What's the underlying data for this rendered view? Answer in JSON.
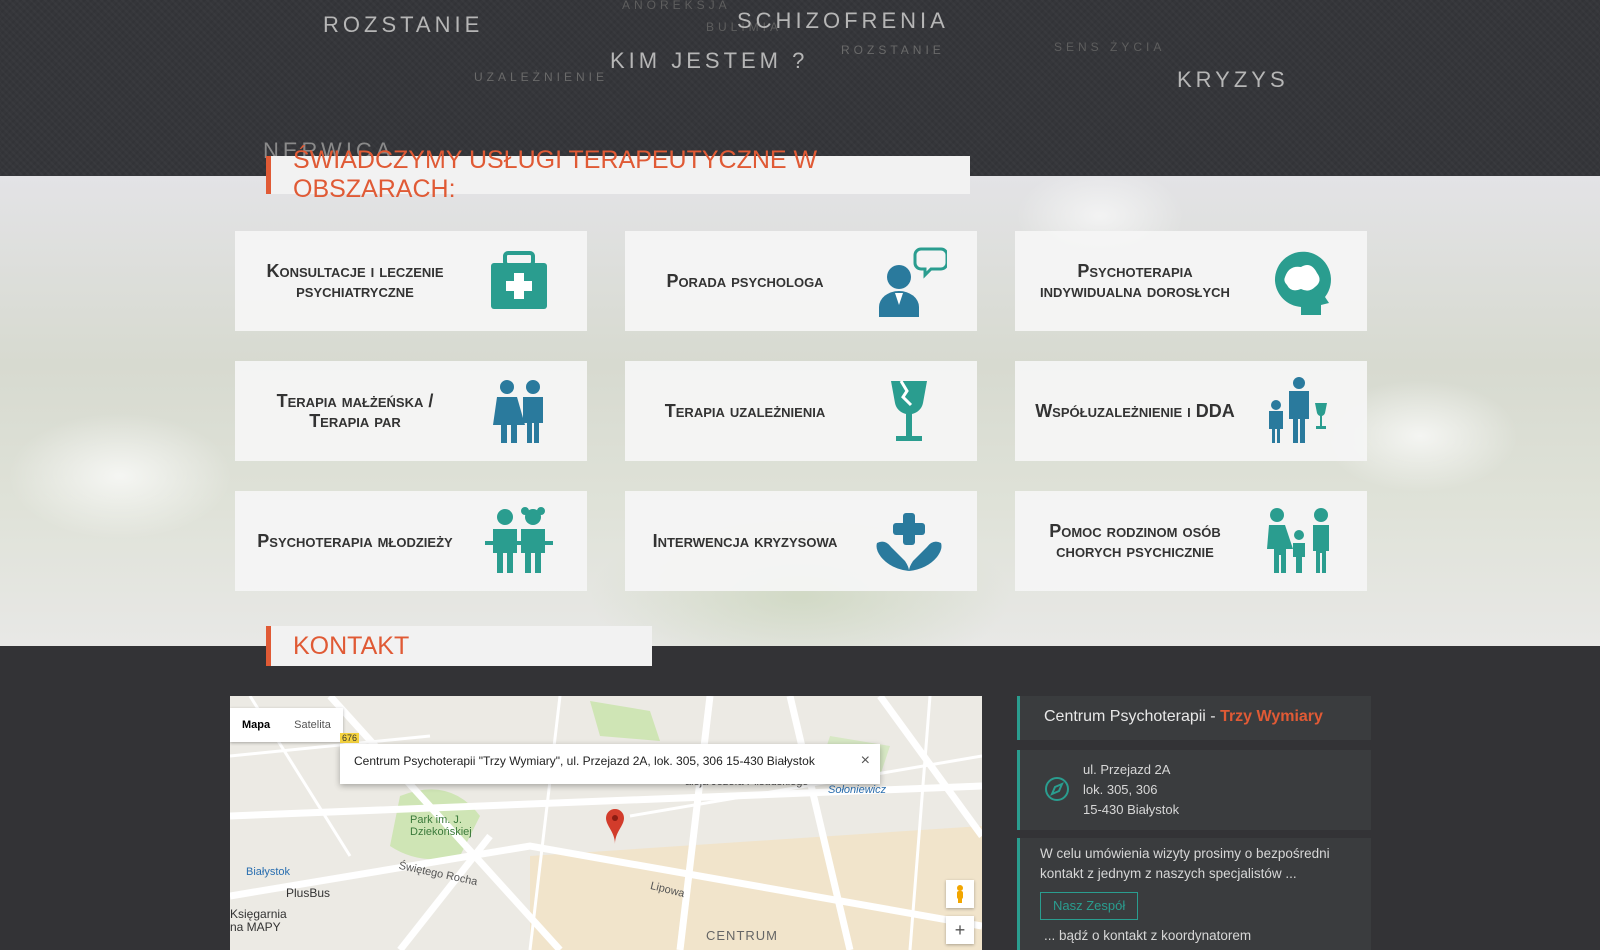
{
  "header_words": [
    {
      "text": "ROZSTANIE"
    },
    {
      "text": "ANOREKSJA"
    },
    {
      "text": "BULIMIA"
    },
    {
      "text": "SCHIZOFRENIA"
    },
    {
      "text": "KIM JESTEM ?"
    },
    {
      "text": "ROZSTANIE"
    },
    {
      "text": "UZALEŻNIENIE"
    },
    {
      "text": "SENS ŻYCIA"
    },
    {
      "text": "KRYZYS"
    },
    {
      "text": "NERWICA"
    }
  ],
  "services": {
    "title": "Świadczymy usługi terapeutyczne w obszarach:",
    "cards": [
      {
        "label": "Konsultacje i leczenie psychiatryczne",
        "icon": "medical-kit-icon"
      },
      {
        "label": "Porada psychologa",
        "icon": "psychologist-chat-icon"
      },
      {
        "label": "Psychoterapia indywidualna dorosłych",
        "icon": "brain-head-icon"
      },
      {
        "label": "Terapia małżeńska / Terapia par",
        "icon": "couple-icon"
      },
      {
        "label": "Terapia uzależnienia",
        "icon": "broken-glass-icon"
      },
      {
        "label": "Współuzależnienie i DDA",
        "icon": "family-alcohol-icon"
      },
      {
        "label": "Psychoterapia młodzieży",
        "icon": "teenagers-icon"
      },
      {
        "label": "Interwencja kryzysowa",
        "icon": "hands-cross-icon"
      },
      {
        "label": "Pomoc rodzinom osób chorych psychicznie",
        "icon": "family-icon"
      }
    ]
  },
  "contact": {
    "title": "Kontakt",
    "map": {
      "tab_map": "Mapa",
      "tab_satellite": "Satelita",
      "info": "Centrum Psychoterapii \"Trzy Wymiary\", ul. Przejazd 2A, lok. 305, 306 15-430 Białystok",
      "close": "×",
      "zoom_in": "+",
      "labels": {
        "park": "Park im. J. Dziekońskiej",
        "station": "Białystok",
        "plusbus": "PlusBus",
        "ksiegarnia": "Księgarnia\nna MAPY",
        "centrum": "CENTRUM",
        "pilsudskiego": "aleja Józefa Piłsudskiego",
        "solonowicz": "Sołoniewicz",
        "rocha": "Świętego Rocha",
        "lipowa": "Lipowa",
        "road676": "676"
      }
    },
    "org_prefix": "Centrum Psychoterapii - ",
    "org_accent": "Trzy Wymiary",
    "address": [
      "ul. Przejazd 2A",
      "lok. 305, 306",
      "15-430 Białystok"
    ],
    "info_text": "W celu umówienia wizyty prosimy o bezpośredni kontakt z jednym z naszych specjalistów ...",
    "team_button": "Nasz Zespół",
    "coordinator_text": "... bądź o kontakt z koordynatorem"
  },
  "colors": {
    "accent": "#e05a35",
    "icon": "#2a9d8f",
    "dark": "#35363a"
  }
}
